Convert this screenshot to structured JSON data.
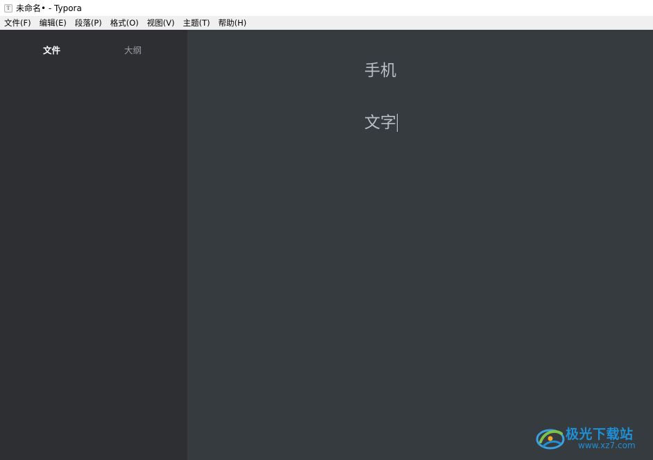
{
  "window": {
    "app_icon_glyph": "T",
    "title": "未命名• - Typora"
  },
  "menubar": {
    "items": [
      {
        "label": "文件(F)"
      },
      {
        "label": "编辑(E)"
      },
      {
        "label": "段落(P)"
      },
      {
        "label": "格式(O)"
      },
      {
        "label": "视图(V)"
      },
      {
        "label": "主题(T)"
      },
      {
        "label": "帮助(H)"
      }
    ]
  },
  "sidebar": {
    "tabs": [
      {
        "label": "文件",
        "active": true
      },
      {
        "label": "大纲",
        "active": false
      }
    ]
  },
  "editor": {
    "paragraphs": [
      "手机",
      "文字"
    ]
  },
  "watermark": {
    "brand_text": "极光下载站",
    "url_text": "www.xz7.com",
    "color": "#1f8fd6"
  },
  "colors": {
    "sidebar_bg": "#2e2f33",
    "editor_bg": "#363b40",
    "text": "#b8bfc6"
  }
}
